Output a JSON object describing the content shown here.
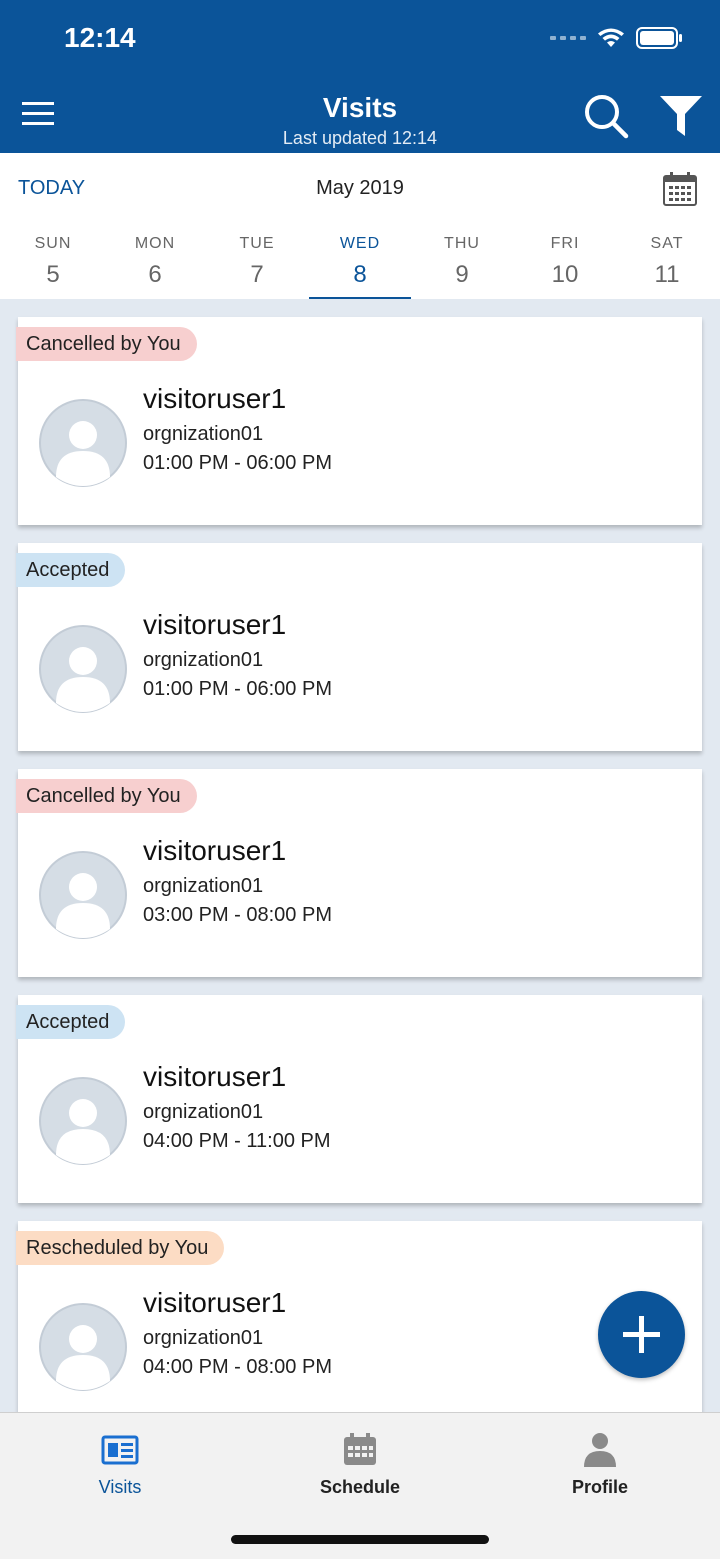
{
  "status_bar": {
    "time": "12:14"
  },
  "header": {
    "title": "Visits",
    "subtitle": "Last updated 12:14"
  },
  "date_bar": {
    "today_label": "TODAY",
    "month": "May 2019",
    "days": [
      {
        "name": "SUN",
        "num": "5"
      },
      {
        "name": "MON",
        "num": "6"
      },
      {
        "name": "TUE",
        "num": "7"
      },
      {
        "name": "WED",
        "num": "8",
        "selected": true
      },
      {
        "name": "THU",
        "num": "9"
      },
      {
        "name": "FRI",
        "num": "10"
      },
      {
        "name": "SAT",
        "num": "11"
      }
    ]
  },
  "visits": [
    {
      "status": "Cancelled by You",
      "status_type": "cancelled",
      "name": "visitoruser1",
      "org": "orgnization01",
      "time": "01:00 PM - 06:00 PM"
    },
    {
      "status": "Accepted",
      "status_type": "accepted",
      "name": "visitoruser1",
      "org": "orgnization01",
      "time": "01:00 PM - 06:00 PM"
    },
    {
      "status": "Cancelled by You",
      "status_type": "cancelled",
      "name": "visitoruser1",
      "org": "orgnization01",
      "time": "03:00 PM - 08:00 PM"
    },
    {
      "status": "Accepted",
      "status_type": "accepted",
      "name": "visitoruser1",
      "org": "orgnization01",
      "time": "04:00 PM - 11:00 PM"
    },
    {
      "status": "Rescheduled by You",
      "status_type": "rescheduled",
      "name": "visitoruser1",
      "org": "orgnization01",
      "time": "04:00 PM - 08:00 PM"
    }
  ],
  "tabs": [
    {
      "label": "Visits",
      "icon": "visits-icon",
      "active": true
    },
    {
      "label": "Schedule",
      "icon": "schedule-icon"
    },
    {
      "label": "Profile",
      "icon": "profile-icon"
    }
  ],
  "colors": {
    "primary": "#0b5499",
    "cancelled_badge": "#f7cfcf",
    "accepted_badge": "#cde3f3",
    "rescheduled_badge": "#fcdcc4"
  }
}
